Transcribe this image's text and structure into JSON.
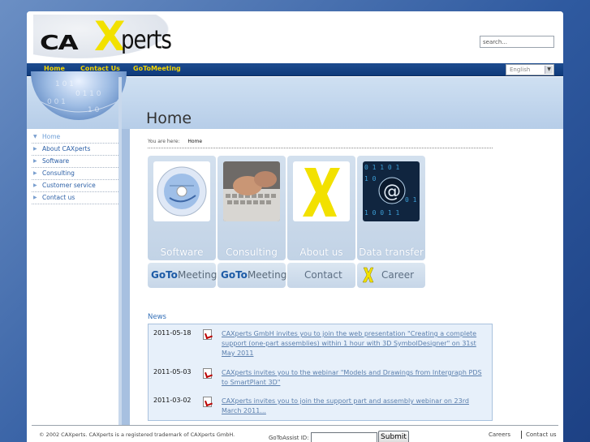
{
  "header": {
    "logo_text_ca": "CA",
    "logo_text_x": "X",
    "logo_text_perts": "perts",
    "search_placeholder": "search..."
  },
  "nav": {
    "items": [
      "Home",
      "Contact Us",
      "GoToMeeting"
    ],
    "language": "English"
  },
  "banner": {
    "title": "Home"
  },
  "sidebar": {
    "items": [
      {
        "label": "Home",
        "active": true
      },
      {
        "label": "About CAXperts",
        "active": false
      },
      {
        "label": "Software",
        "active": false
      },
      {
        "label": "Consulting",
        "active": false
      },
      {
        "label": "Customer service",
        "active": false
      },
      {
        "label": "Contact us",
        "active": false
      }
    ]
  },
  "breadcrumb": {
    "prefix": "You are here:",
    "current": "Home"
  },
  "tiles": [
    {
      "label": "Software",
      "icon": "cd-icon"
    },
    {
      "label": "Consulting",
      "icon": "keyboard-hands-icon"
    },
    {
      "label": "About us",
      "icon": "x-logo-icon"
    },
    {
      "label": "Data transfer",
      "icon": "at-sign-binary-icon"
    }
  ],
  "small_tiles": [
    {
      "label_bold": "GoTo",
      "label_light": "Meeting",
      "tm": "®"
    },
    {
      "label_bold": "GoTo",
      "label_light": "Meeting",
      "tm": "®"
    },
    {
      "label": "Contact"
    },
    {
      "label": "Career"
    }
  ],
  "news": {
    "title": "News",
    "items": [
      {
        "date": "2011-05-18",
        "text": "CAXperts GmbH invites you to join the web presentation \"Creating a complete support (one-part assemblies) within 1 hour with 3D SymbolDesigner\" on 31st May 2011"
      },
      {
        "date": "2011-05-03",
        "text": "CAXperts invites you to the webinar \"Models and Drawings from Intergraph PDS to SmartPlant 3D\""
      },
      {
        "date": "2011-03-02",
        "text": "CAXperts invites you to join the support part and assembly webinar on 23rd March 2011..."
      }
    ]
  },
  "footer": {
    "copyright": "© 2002 CAXperts. CAXperts is a registered trademark of CAXperts GmbH.",
    "assist_label": "GoToAssist ID:",
    "submit_label": "Submit",
    "links": [
      "Careers",
      "Contact us"
    ]
  },
  "colors": {
    "nav_bg": "#0f3a7a",
    "nav_text": "#f2d400",
    "accent_yellow": "#f2e100",
    "link_blue": "#5b7fad"
  }
}
